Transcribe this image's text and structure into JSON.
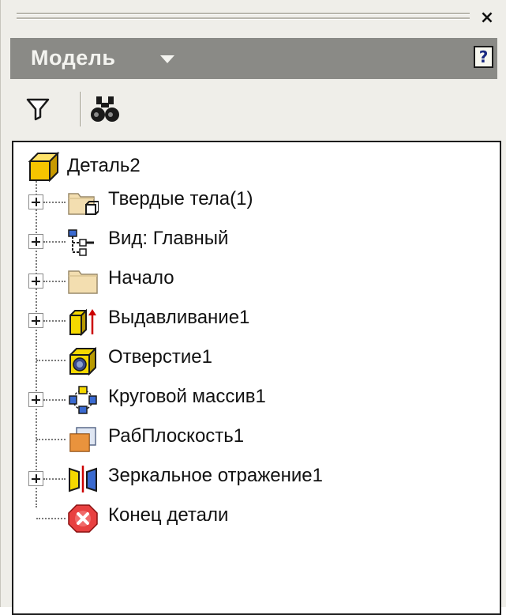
{
  "window": {
    "close_glyph": "×"
  },
  "header": {
    "title": "Модель",
    "help_glyph": "?"
  },
  "toolbar": {
    "buttons": [
      "filter-icon",
      "find-binoculars-icon"
    ]
  },
  "tree": {
    "root": {
      "label": "Деталь2",
      "icon": "part-cube-icon"
    },
    "items": [
      {
        "label": "Твердые тела(1)",
        "icon": "solid-bodies-folder-icon",
        "expandable": true
      },
      {
        "label": "Вид: Главный",
        "icon": "view-representation-icon",
        "expandable": true
      },
      {
        "label": "Начало",
        "icon": "origin-folder-icon",
        "expandable": true
      },
      {
        "label": "Выдавливание1",
        "icon": "extrusion-icon",
        "expandable": true
      },
      {
        "label": "Отверстие1",
        "icon": "hole-icon",
        "expandable": false
      },
      {
        "label": "Круговой массив1",
        "icon": "circular-pattern-icon",
        "expandable": true
      },
      {
        "label": "РабПлоскость1",
        "icon": "work-plane-icon",
        "expandable": false
      },
      {
        "label": "Зеркальное отражение1",
        "icon": "mirror-icon",
        "expandable": true
      },
      {
        "label": "Конец детали",
        "icon": "end-of-part-icon",
        "expandable": false
      }
    ]
  },
  "colors": {
    "header_bg": "#8a8a86",
    "panel_bg": "#efeee9",
    "part_yellow": "#f5c400"
  }
}
